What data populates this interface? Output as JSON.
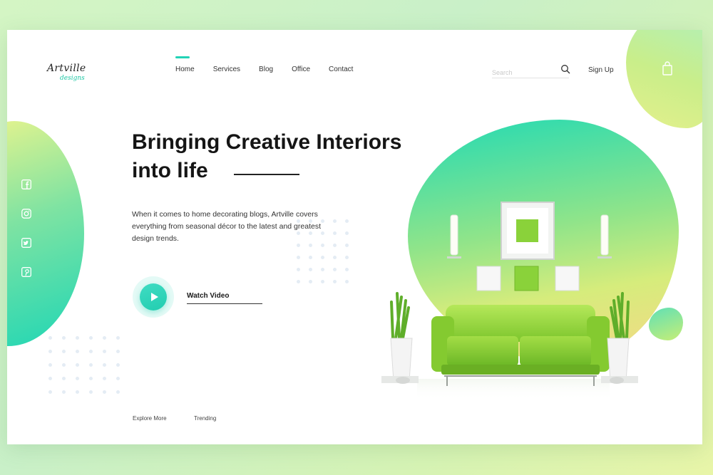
{
  "brand": {
    "name": "Artville",
    "tagline": "designs"
  },
  "nav": {
    "items": [
      "Home",
      "Services",
      "Blog",
      "Office",
      "Contact"
    ],
    "active": "Home"
  },
  "search": {
    "placeholder": "Search"
  },
  "header": {
    "signup_label": "Sign Up"
  },
  "icons": {
    "cart": "shopping-bag-icon",
    "search": "search-icon",
    "play": "play-icon",
    "social": [
      "facebook-icon",
      "instagram-icon",
      "twitter-icon",
      "pinterest-icon"
    ]
  },
  "hero": {
    "headline_line1": "Bringing Creative Interiors",
    "headline_line2": "into life",
    "description": "When it comes to home decorating blogs, Artville covers everything from seasonal décor to the latest and greatest design trends.",
    "watch_video_label": "Watch Video"
  },
  "footer": {
    "explore_label": "Explore More",
    "trending_label": "Trending"
  },
  "colors": {
    "accent": "#22d3b6",
    "sofa": "#8fd13a",
    "background": "#d4f5c4"
  }
}
